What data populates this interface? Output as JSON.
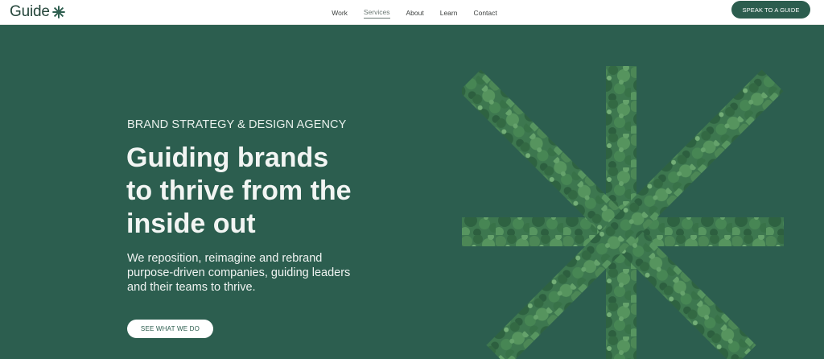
{
  "brand": {
    "name": "Guide",
    "logo_icon": "asterisk-icon"
  },
  "nav": {
    "items": [
      {
        "label": "Work"
      },
      {
        "label": "Services",
        "active": true
      },
      {
        "label": "About"
      },
      {
        "label": "Learn"
      },
      {
        "label": "Contact"
      }
    ]
  },
  "header_cta": {
    "label": "SPEAK TO A GUIDE"
  },
  "hero": {
    "eyebrow": "BRAND STRATEGY & DESIGN AGENCY",
    "headline_lines": [
      "Guiding brands",
      "to thrive from the",
      "inside out"
    ],
    "subtext_lines": [
      "We reposition, reimagine and rebrand",
      "purpose-driven companies, guiding leaders",
      "and their teams to thrive."
    ],
    "cta": {
      "label": "SEE WHAT WE DO"
    },
    "graphic_icon": "forest-asterisk-icon"
  },
  "colors": {
    "brand_green": "#2c5e4f",
    "dark_green": "#24453a",
    "white": "#ffffff"
  }
}
